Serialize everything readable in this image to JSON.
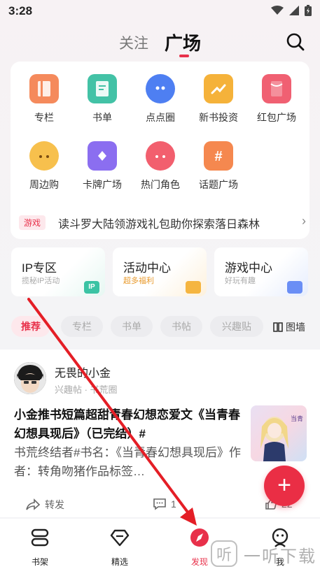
{
  "status": {
    "time": "3:28"
  },
  "header": {
    "tabs": [
      {
        "label": "关注"
      },
      {
        "label": "广场"
      }
    ]
  },
  "features": [
    {
      "label": "专栏",
      "color": "#f58a5c"
    },
    {
      "label": "书单",
      "color": "#43c2a6"
    },
    {
      "label": "点点圈",
      "color": "#4e7ff2"
    },
    {
      "label": "新书投资",
      "color": "#f5b23a"
    },
    {
      "label": "红包广场",
      "color": "#f06072"
    },
    {
      "label": "周边购",
      "color": "#f7c04d"
    },
    {
      "label": "卡牌广场",
      "color": "#8b6ef0"
    },
    {
      "label": "热门角色",
      "color": "#f25f6e"
    },
    {
      "label": "话题广场",
      "color": "#f5884f"
    }
  ],
  "promo": {
    "badge": "游戏",
    "text": "读斗罗大陆领游戏礼包助你探索落日森林"
  },
  "zones": [
    {
      "title": "IP专区",
      "subtitle": "揽秘IP活动",
      "badge": "IP",
      "color": "#3bc3a4"
    },
    {
      "title": "活动中心",
      "subtitle": "超多福利",
      "color": "#f5b540"
    },
    {
      "title": "游戏中心",
      "subtitle": "好玩有趣",
      "color": "#6a8ef5"
    }
  ],
  "chips": [
    {
      "label": "推荐"
    },
    {
      "label": "专栏"
    },
    {
      "label": "书单"
    },
    {
      "label": "书帖"
    },
    {
      "label": "兴趣贴"
    }
  ],
  "grid_label": "图墙",
  "post": {
    "user": "无畏的小金",
    "meta": "兴趣帖 · 书荒圈",
    "title": "小金推书短篇超甜青春幻想恋爱文《当青春幻想具现后》（已完结）#",
    "body": "书荒终结者#书名：《当青春幻想具现后》作者：转角吻猪作品标签…",
    "thumb_text": "当青春幻想具现后",
    "actions": {
      "share": "转发",
      "comments": "1",
      "likes": "22"
    }
  },
  "fab": "+",
  "nav": [
    {
      "label": "书架"
    },
    {
      "label": "精选"
    },
    {
      "label": "发现"
    },
    {
      "label": "我"
    }
  ],
  "watermark": "一听下载",
  "colors": {
    "accent": "#e8304a"
  }
}
